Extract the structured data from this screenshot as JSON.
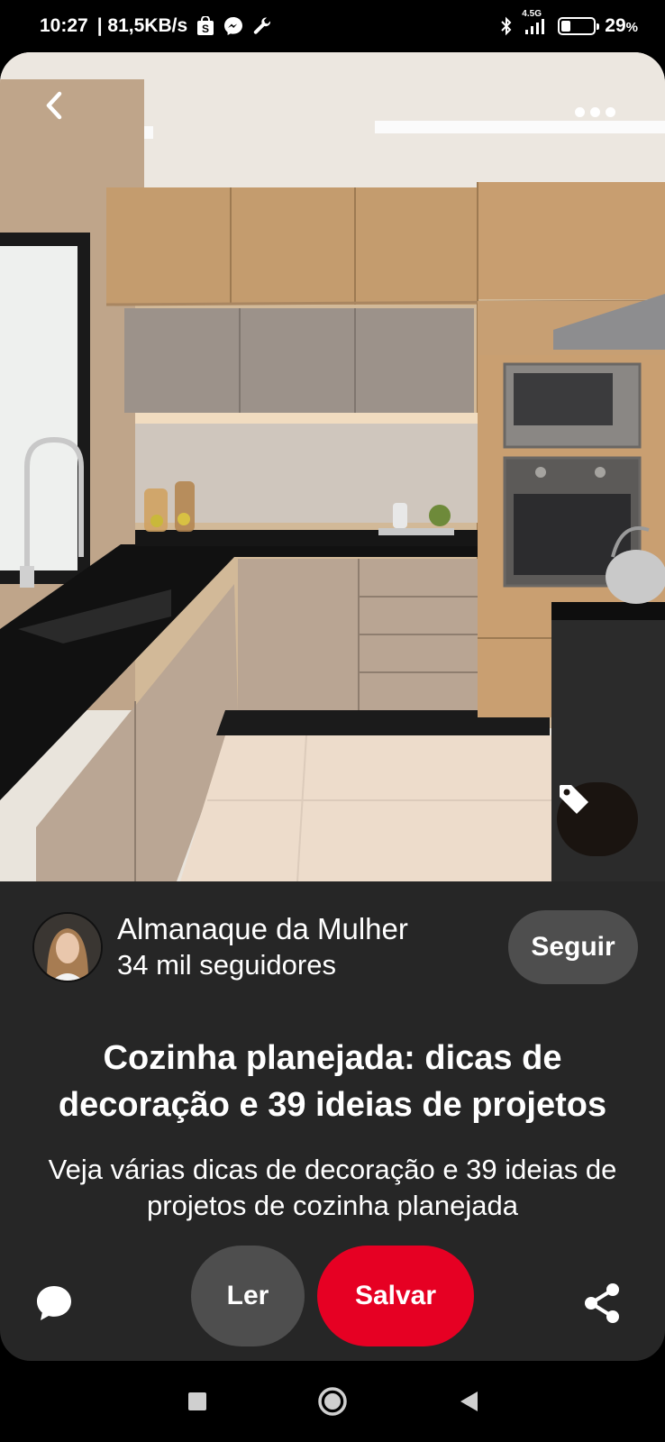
{
  "status_bar": {
    "time": "10:27",
    "net_speed": "| 81,5KB/s",
    "network_label": "4.5G",
    "battery_percent": "29",
    "battery_unit": "%",
    "battery_level": 0.29,
    "icons": [
      "shopping-bag-icon",
      "messenger-icon",
      "wrench-icon",
      "bluetooth-icon",
      "signal-icon",
      "battery-icon"
    ]
  },
  "pin": {
    "image_alt_icon_names": [
      "back-arrow-icon",
      "more-options-icon",
      "tag-icon"
    ],
    "creator": {
      "name": "Almanaque da Mulher",
      "followers": "34 mil seguidores",
      "follow_label": "Seguir"
    },
    "title": "Cozinha planejada: dicas de decoração e 39 ideias de projetos",
    "description": "Veja várias dicas de decoração e 39 ideias de projetos de cozinha planejada"
  },
  "actions": {
    "read_label": "Ler",
    "save_label": "Salvar",
    "icons": [
      "comment-icon",
      "share-icon"
    ]
  },
  "colors": {
    "save": "#e60023",
    "card": "#262626",
    "secondary_button": "#4e4e4e"
  },
  "nav": {
    "icons": [
      "recents-square-icon",
      "home-circle-icon",
      "back-triangle-icon"
    ]
  }
}
